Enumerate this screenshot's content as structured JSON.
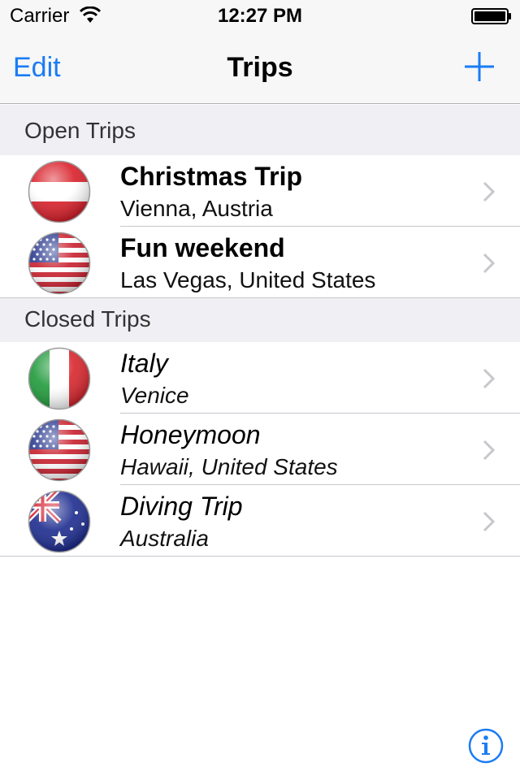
{
  "status_bar": {
    "carrier": "Carrier",
    "time": "12:27 PM"
  },
  "nav": {
    "edit_label": "Edit",
    "title": "Trips",
    "add_icon": "plus-icon",
    "accent": "#1a7cf5"
  },
  "sections": [
    {
      "header": "Open Trips",
      "rows": [
        {
          "title": "Christmas Trip",
          "subtitle": "Vienna, Austria",
          "flag": "austria-flag-icon"
        },
        {
          "title": "Fun weekend",
          "subtitle": "Las Vegas, United States",
          "flag": "usa-flag-icon"
        }
      ]
    },
    {
      "header": "Closed Trips",
      "rows": [
        {
          "title": "Italy",
          "subtitle": "Venice",
          "flag": "italy-flag-icon"
        },
        {
          "title": "Honeymoon",
          "subtitle": "Hawaii, United States",
          "flag": "usa-flag-icon"
        },
        {
          "title": "Diving Trip",
          "subtitle": "Australia",
          "flag": "australia-flag-icon"
        }
      ]
    }
  ],
  "footer": {
    "info_icon": "info-icon"
  }
}
